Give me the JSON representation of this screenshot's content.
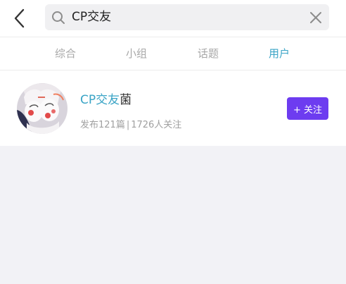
{
  "search": {
    "query": "CP交友"
  },
  "tabs": [
    {
      "label": "综合",
      "active": false
    },
    {
      "label": "小组",
      "active": false
    },
    {
      "label": "话题",
      "active": false
    },
    {
      "label": "用户",
      "active": true
    }
  ],
  "result": {
    "name_highlight": "CP交友",
    "name_rest": "菌",
    "meta_posts": "发布121篇",
    "meta_sep": "|",
    "meta_followers": "1726人关注",
    "follow_label": "+ 关注"
  },
  "icons": {
    "back": "back-arrow-icon",
    "search": "search-icon",
    "clear": "clear-icon"
  },
  "colors": {
    "accent": "#3aa4c6",
    "follow_button": "#6d3cf0",
    "muted_text": "#a8a8a8",
    "page_background": "#f2f2f6"
  }
}
